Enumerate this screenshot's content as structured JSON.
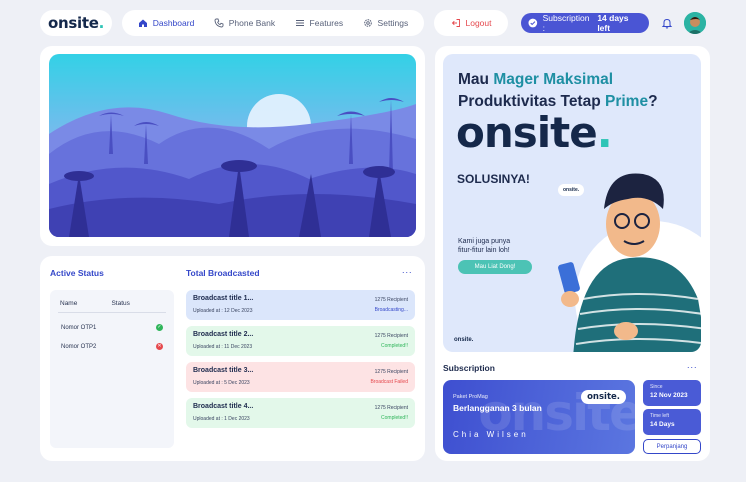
{
  "brand": {
    "name": "onsite",
    "dot": "."
  },
  "nav": [
    {
      "label": "Dashboard",
      "icon": "home-icon",
      "active": true
    },
    {
      "label": "Phone Bank",
      "icon": "phone-icon",
      "active": false
    },
    {
      "label": "Features",
      "icon": "list-icon",
      "active": false
    },
    {
      "label": "Settings",
      "icon": "gear-icon",
      "active": false
    }
  ],
  "logout": {
    "label": "Logout",
    "icon": "logout-icon"
  },
  "subscription_badge": {
    "label": "Subscription :",
    "value": "14 days left",
    "icon": "check-circle-icon"
  },
  "header_icons": [
    "bell-icon",
    "avatar"
  ],
  "active_status": {
    "title": "Active Status",
    "columns": [
      "Name",
      "Status"
    ],
    "rows": [
      {
        "name": "Nomor OTP1",
        "status": "active",
        "status_icon": "check-icon"
      },
      {
        "name": "Nomor OTP2",
        "status": "inactive",
        "status_icon": "close-icon"
      }
    ]
  },
  "broadcast": {
    "title": "Total Broadcasted",
    "more": "...",
    "items": [
      {
        "title": "Broadcast title 1...",
        "uploaded": "Uploaded at : 12 Dec 2023",
        "recipient": "1275 Recipient",
        "status": "Broadcasting...",
        "bg": "#dbe6fb",
        "status_color": "#3447c9"
      },
      {
        "title": "Broadcast title 2...",
        "uploaded": "Uploaded at : 11 Dec 2023",
        "recipient": "1275 Recipient",
        "status": "Completed!!",
        "bg": "#e3f8ea",
        "status_color": "#2fb55a"
      },
      {
        "title": "Broadcast title 3...",
        "uploaded": "Uploaded at : 5 Dec 2023",
        "recipient": "1275 Recipient",
        "status": "Broadcast Failed",
        "bg": "#fde3e4",
        "status_color": "#e5484d"
      },
      {
        "title": "Broadcast title 4...",
        "uploaded": "Uploaded at : 1 Dec 2023",
        "recipient": "1275 Recipient",
        "status": "Completed!!",
        "bg": "#e3f8ea",
        "status_color": "#2fb55a"
      }
    ]
  },
  "promo": {
    "line1_a": "Mau ",
    "line1_b": "Mager Maksimal",
    "line2_a": "Produktivitas Tetap ",
    "line2_b": "Prime",
    "line2_c": "?",
    "brand": "onsite",
    "solusi": "SOLUSINYA!",
    "small_1": "Kami juga punya",
    "small_2": "fitur-fitur lain loh!",
    "cta": "Mau Liat Dong!",
    "bubble": "onsite.",
    "footer_brand": "onsite."
  },
  "subscription": {
    "title": "Subscription",
    "more": "...",
    "package": "Paket ProMag",
    "plan": "Berlangganan 3 bulan",
    "holder": "Chia Wilsen",
    "logo": "onsite.",
    "watermark": "onsite",
    "since_label": "Since",
    "since_value": "12 Nov 2023",
    "timeleft_label": "Time left",
    "timeleft_value": "14 Days",
    "extend": "Perpanjang"
  },
  "colors": {
    "accent": "#3447c9",
    "teal": "#2ec4b6",
    "navy": "#15284a",
    "danger": "#e5484d",
    "success": "#2fb55a"
  }
}
